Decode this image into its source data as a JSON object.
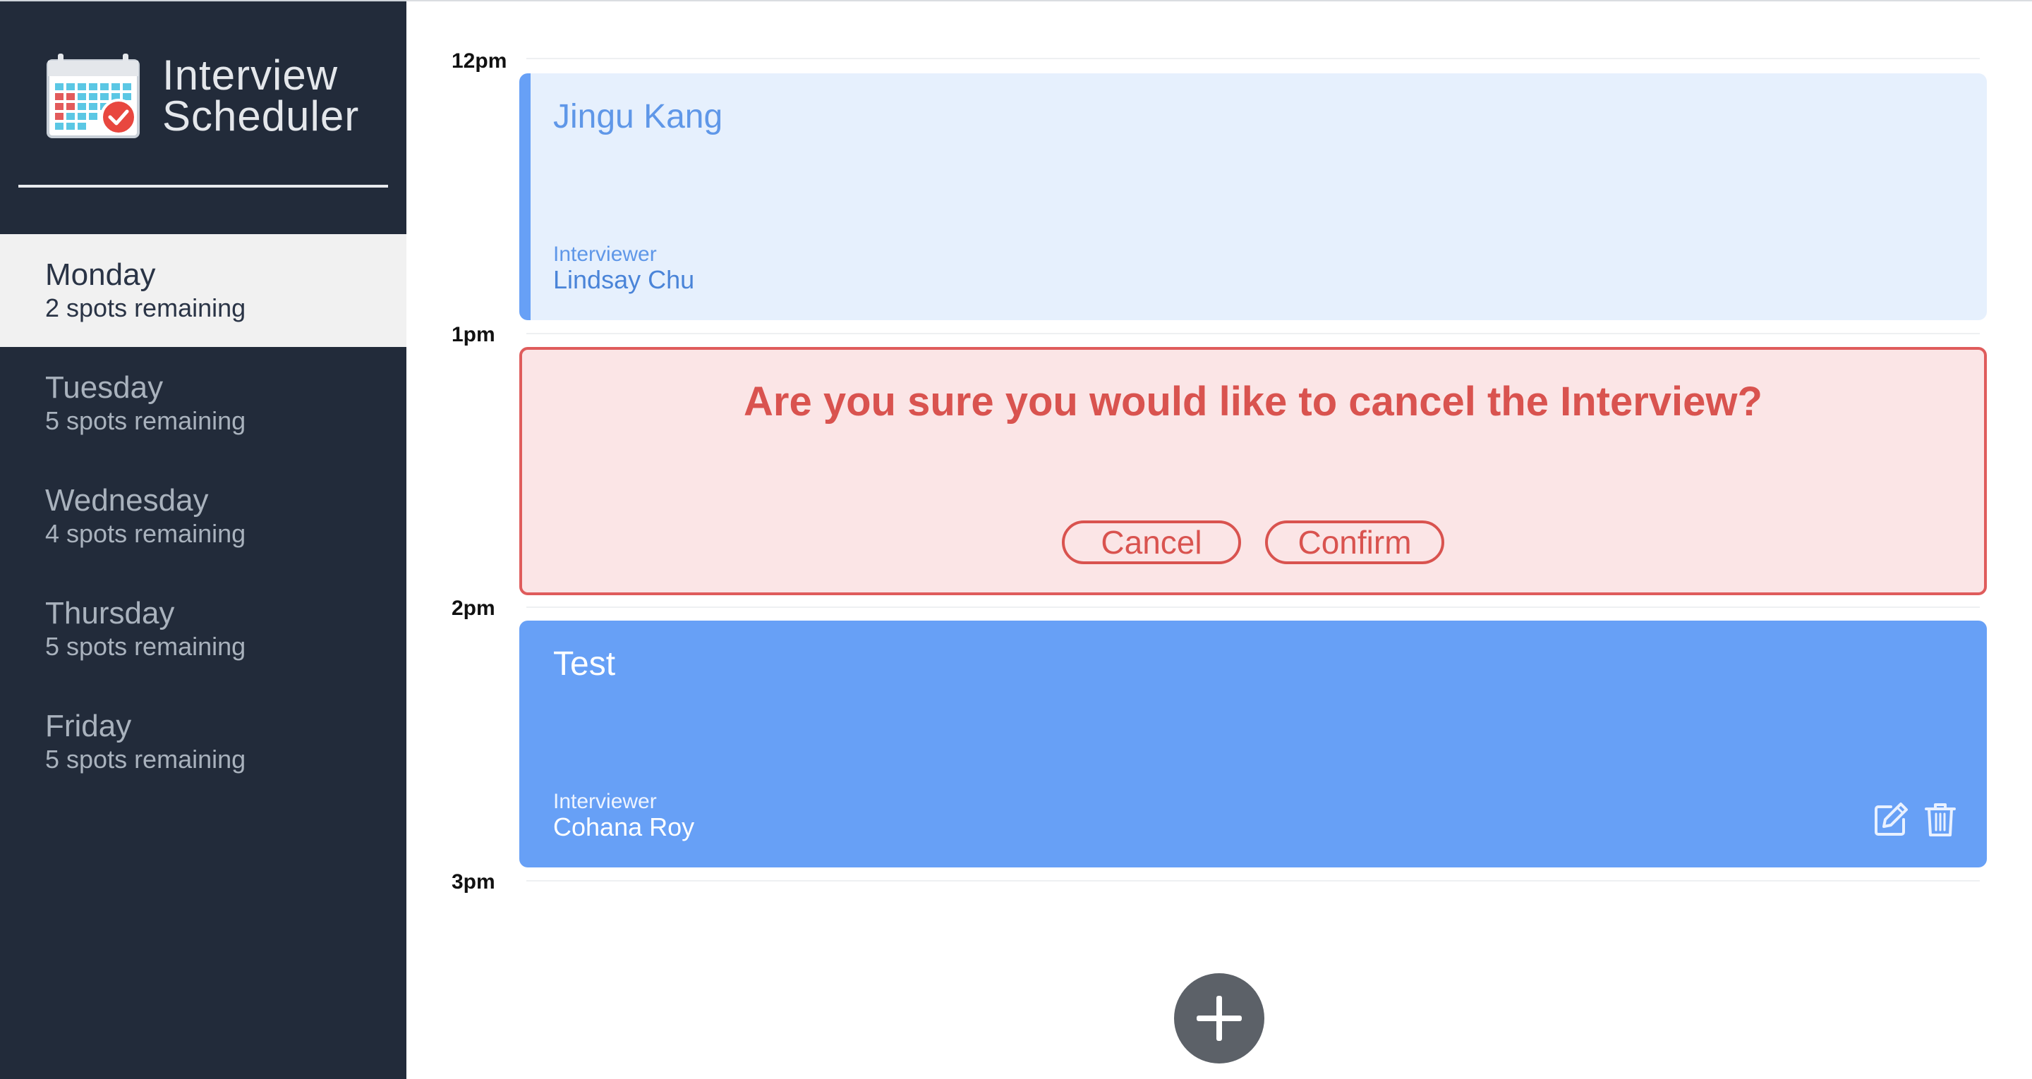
{
  "brand": {
    "title_line1": "Interview",
    "title_line2": "Scheduler"
  },
  "days": [
    {
      "name": "Monday",
      "spots": "2 spots remaining",
      "selected": true
    },
    {
      "name": "Tuesday",
      "spots": "5 spots remaining",
      "selected": false
    },
    {
      "name": "Wednesday",
      "spots": "4 spots remaining",
      "selected": false
    },
    {
      "name": "Thursday",
      "spots": "5 spots remaining",
      "selected": false
    },
    {
      "name": "Friday",
      "spots": "5 spots remaining",
      "selected": false
    }
  ],
  "hours": [
    "12pm",
    "1pm",
    "2pm",
    "3pm"
  ],
  "appointments": {
    "first": {
      "student": "Jingu Kang",
      "interviewer_label": "Interviewer",
      "interviewer": "Lindsay Chu"
    },
    "confirm": {
      "message": "Are you sure you would like to cancel the Interview?",
      "cancel_label": "Cancel",
      "confirm_label": "Confirm"
    },
    "third": {
      "student": "Test",
      "interviewer_label": "Interviewer",
      "interviewer": "Cohana Roy"
    }
  },
  "colors": {
    "sidebar": "#222b3a",
    "accent_blue": "#67a0f6",
    "danger": "#d9534f",
    "add_button": "#5c6168"
  },
  "icons": {
    "logo": "calendar-check-icon",
    "edit": "edit-icon",
    "delete": "trash-icon",
    "add": "plus-icon"
  }
}
